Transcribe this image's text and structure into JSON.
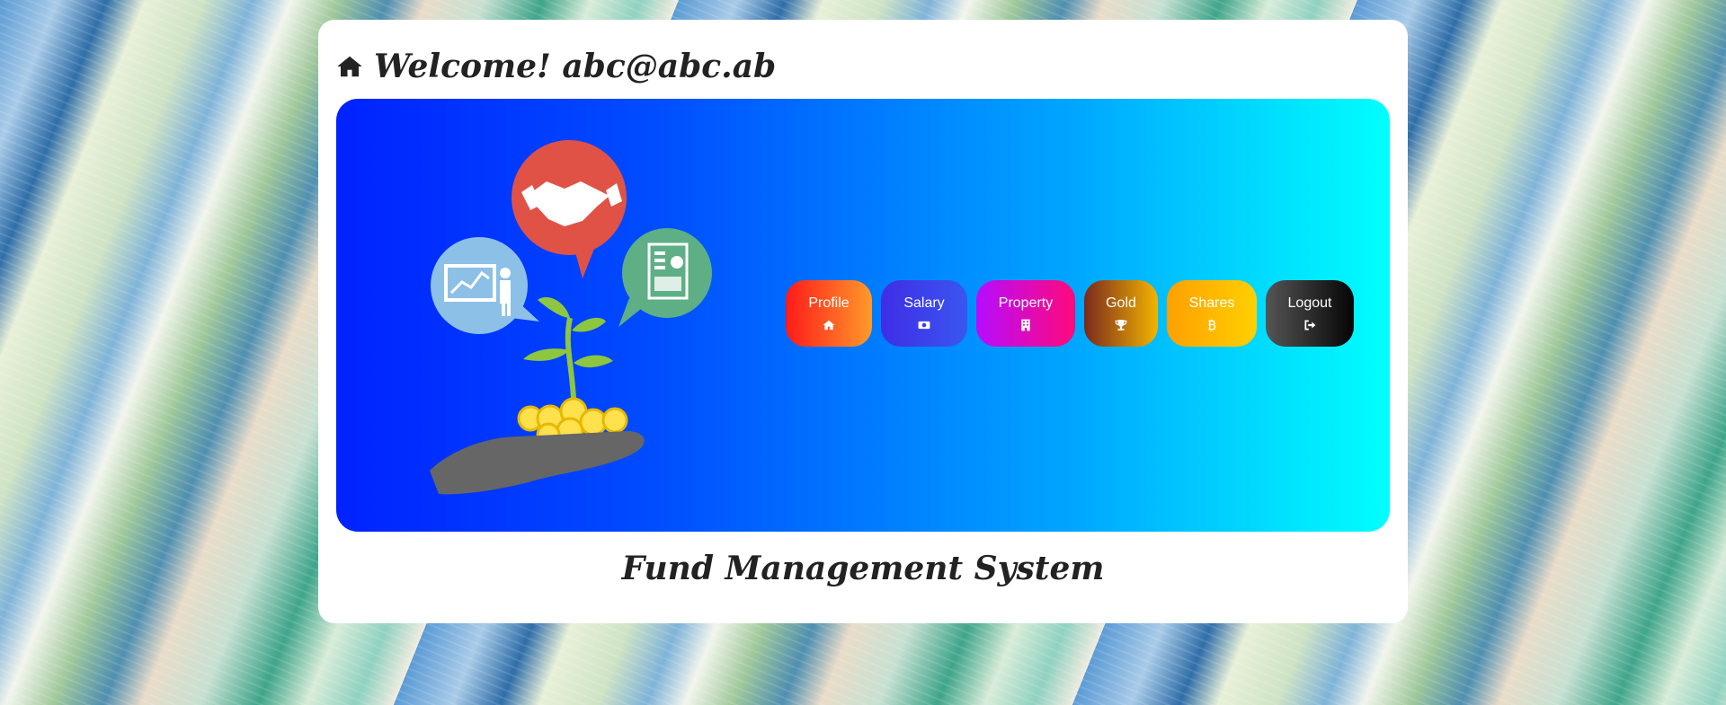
{
  "header": {
    "welcome_text": "Welcome! abc@abc.ab",
    "home_icon": "home-icon"
  },
  "nav": [
    {
      "label": "Profile",
      "icon": "home-icon"
    },
    {
      "label": "Salary",
      "icon": "money-icon"
    },
    {
      "label": "Property",
      "icon": "building-icon"
    },
    {
      "label": "Gold",
      "icon": "trophy-icon"
    },
    {
      "label": "Shares",
      "icon": "bitcoin-icon"
    },
    {
      "label": "Logout",
      "icon": "sign-out-icon"
    }
  ],
  "footer": {
    "title": "Fund Management System"
  },
  "colors": {
    "hero_gradient": [
      "#0022ff",
      "#00ffff"
    ],
    "profile": [
      "#ff1a1a",
      "#ff9a2a"
    ],
    "salary": [
      "#3f2de6",
      "#3a56f0"
    ],
    "property": [
      "#b60cff",
      "#ff0a7a"
    ],
    "gold": [
      "#7a2a1c",
      "#f2b400"
    ],
    "shares": [
      "#ffa000",
      "#ffd000"
    ],
    "logout": [
      "#555555",
      "#050505"
    ]
  }
}
